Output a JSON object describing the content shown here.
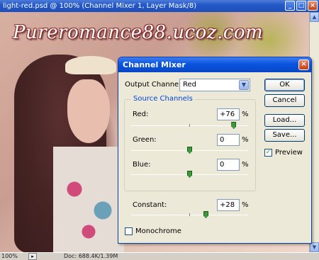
{
  "document": {
    "title": "light-red.psd @ 100% (Channel Mixer 1, Layer Mask/8)",
    "watermark": "Pureromance88.ucoz.com",
    "status_zoom": "100%",
    "status_doc": "Doc: 688.4K/1.39M"
  },
  "dialog": {
    "title": "Channel Mixer",
    "output_channel_label": "Output Channel:",
    "output_channel_value": "Red",
    "source_channels_label": "Source Channels",
    "channels": [
      {
        "label": "Red:",
        "value": "+76",
        "level": 76
      },
      {
        "label": "Green:",
        "value": "0",
        "level": 0
      },
      {
        "label": "Blue:",
        "value": "0",
        "level": 0
      }
    ],
    "constant": {
      "label": "Constant:",
      "value": "+28",
      "level": 28
    },
    "percent": "%",
    "monochrome_label": "Monochrome",
    "monochrome_checked": false,
    "buttons": {
      "ok": "OK",
      "cancel": "Cancel",
      "load": "Load...",
      "save": "Save..."
    },
    "preview_label": "Preview",
    "preview_checked": true
  },
  "colors": {
    "dialog_title": "#0a54e0",
    "slider_thumb": "#3a9a3a",
    "group_title": "#0046d5"
  }
}
